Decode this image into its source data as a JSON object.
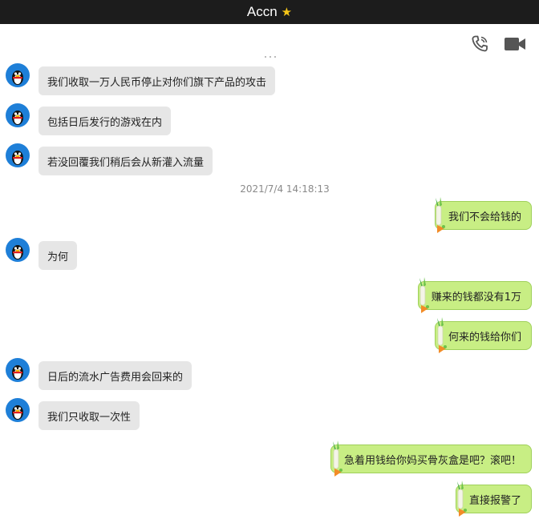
{
  "header": {
    "title": "Accn",
    "star_icon": "star-icon"
  },
  "toolbar": {
    "call_icon": "phone-icon",
    "video_icon": "video-camera-icon"
  },
  "colors": {
    "header_bg": "#1c1c1c",
    "incoming_bubble": "#e6e6e6",
    "outgoing_bubble": "#c8ee84",
    "avatar": "#1e7fd8"
  },
  "messages": [
    {
      "side": "incoming",
      "text": "我们收取一万人民币停止对你们旗下产品的攻击"
    },
    {
      "side": "incoming",
      "text": "包括日后发行的游戏在内"
    },
    {
      "side": "incoming",
      "text": "若没回覆我们稍后会从新灌入流量"
    },
    {
      "side": "timestamp",
      "text": "2021/7/4 14:18:13"
    },
    {
      "side": "outgoing",
      "text": "我们不会给钱的"
    },
    {
      "side": "incoming",
      "text": "为何"
    },
    {
      "side": "outgoing",
      "text": "赚来的钱都没有1万"
    },
    {
      "side": "outgoing",
      "text": "何来的钱给你们"
    },
    {
      "side": "incoming",
      "text": "日后的流水广告费用会回来的"
    },
    {
      "side": "incoming",
      "text": "我们只收取一次性"
    },
    {
      "side": "outgoing",
      "text": "急着用钱给你妈买骨灰盒是吧？滚吧！"
    },
    {
      "side": "outgoing",
      "text": "直接报警了"
    }
  ]
}
